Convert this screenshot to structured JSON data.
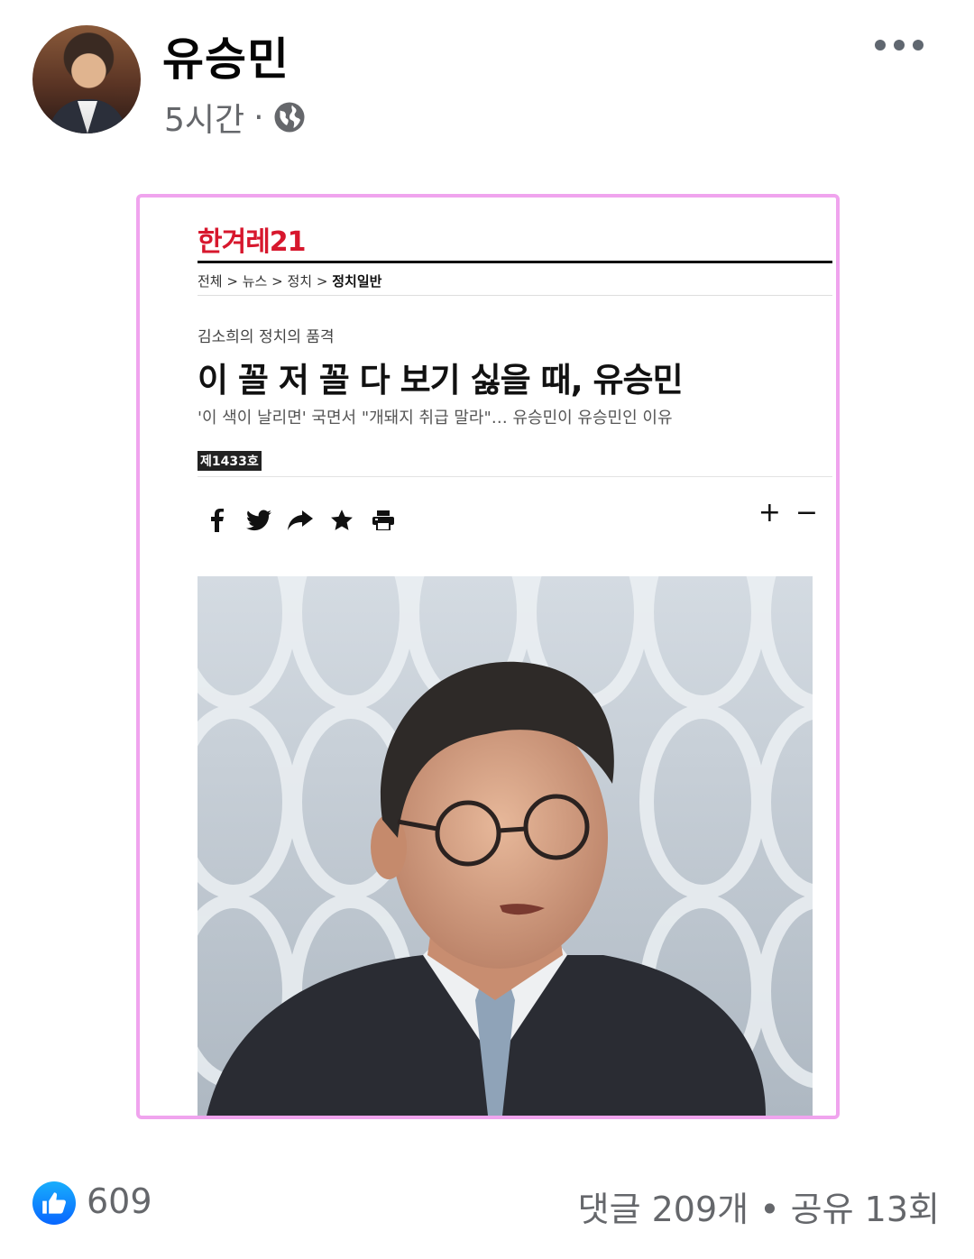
{
  "post": {
    "author": "유승민",
    "time": "5시간",
    "separator": "·",
    "privacy_icon": "globe-icon",
    "more_icon": "more-options-icon"
  },
  "article": {
    "logo": "한겨레21",
    "breadcrumb": [
      "전체",
      "뉴스",
      "정치",
      "정치일반"
    ],
    "breadcrumb_sep": ">",
    "column": "김소희의 정치의 품격",
    "headline": "이 꼴 저 꼴 다 보기 싫을 때, 유승민",
    "subhead": "'이 색이 날리면' 국면서 \"개돼지 취급 말라\"… 유승민이 유승민인 이유",
    "issue": "제1433호",
    "share_icons": [
      "facebook-icon",
      "twitter-icon",
      "share-icon",
      "star-icon",
      "print-icon"
    ],
    "font_plus": "+",
    "font_minus": "−",
    "border_color": "#f0a4ee"
  },
  "reactions": {
    "like_count": "609",
    "comments_shares": "댓글 209개 • 공유 13회",
    "like_color": "#0866ff"
  }
}
